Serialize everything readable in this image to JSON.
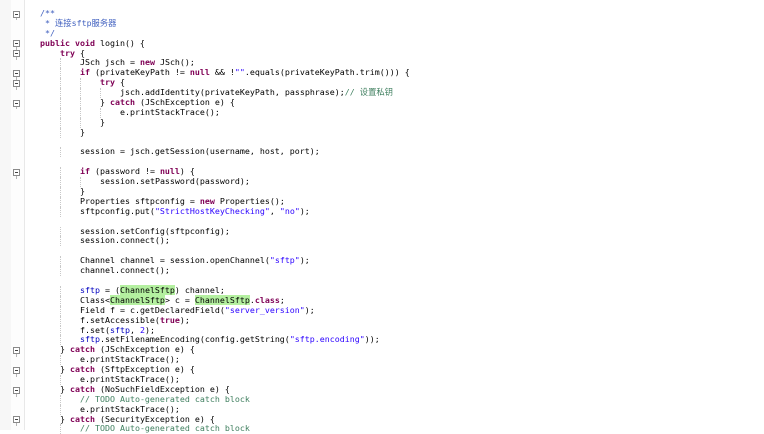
{
  "editor": {
    "lines": [
      {
        "indent": 0,
        "tokens": [
          [
            "jd",
            "/**"
          ]
        ]
      },
      {
        "indent": 0,
        "tokens": [
          [
            "jd",
            " * 连接sftp服务器"
          ]
        ]
      },
      {
        "indent": 0,
        "tokens": [
          [
            "jd",
            " */"
          ]
        ]
      },
      {
        "indent": 0,
        "tokens": [
          [
            "k",
            "public"
          ],
          [
            "n",
            " "
          ],
          [
            "k",
            "void"
          ],
          [
            "n",
            " login() {"
          ]
        ]
      },
      {
        "indent": 1,
        "tokens": [
          [
            "k",
            "try"
          ],
          [
            "n",
            " {"
          ]
        ]
      },
      {
        "indent": 2,
        "tokens": [
          [
            "n",
            "JSch jsch = "
          ],
          [
            "k",
            "new"
          ],
          [
            "n",
            " JSch();"
          ]
        ]
      },
      {
        "indent": 2,
        "tokens": [
          [
            "k",
            "if"
          ],
          [
            "n",
            " (privateKeyPath != "
          ],
          [
            "k",
            "null"
          ],
          [
            "n",
            " && !"
          ],
          [
            "s",
            "\"\""
          ],
          [
            "n",
            ".equals(privateKeyPath.trim())) {"
          ]
        ]
      },
      {
        "indent": 3,
        "tokens": [
          [
            "k",
            "try"
          ],
          [
            "n",
            " {"
          ]
        ]
      },
      {
        "indent": 4,
        "tokens": [
          [
            "n",
            "jsch.addIdentity(privateKeyPath, passphrase);"
          ],
          [
            "c",
            "// 设置私钥"
          ]
        ]
      },
      {
        "indent": 3,
        "tokens": [
          [
            "n",
            "} "
          ],
          [
            "k",
            "catch"
          ],
          [
            "n",
            " (JSchException e) {"
          ]
        ]
      },
      {
        "indent": 4,
        "tokens": [
          [
            "n",
            "e.printStackTrace();"
          ]
        ]
      },
      {
        "indent": 3,
        "tokens": [
          [
            "n",
            "}"
          ]
        ]
      },
      {
        "indent": 2,
        "tokens": [
          [
            "n",
            "}"
          ]
        ]
      },
      {
        "indent": 0,
        "tokens": []
      },
      {
        "indent": 2,
        "tokens": [
          [
            "n",
            "session = jsch.getSession(username, host, port);"
          ]
        ]
      },
      {
        "indent": 0,
        "tokens": []
      },
      {
        "indent": 2,
        "tokens": [
          [
            "k",
            "if"
          ],
          [
            "n",
            " (password != "
          ],
          [
            "k",
            "null"
          ],
          [
            "n",
            ") {"
          ]
        ]
      },
      {
        "indent": 3,
        "tokens": [
          [
            "n",
            "session.setPassword(password);"
          ]
        ]
      },
      {
        "indent": 2,
        "tokens": [
          [
            "n",
            "}"
          ]
        ]
      },
      {
        "indent": 2,
        "tokens": [
          [
            "n",
            "Properties sftpconfig = "
          ],
          [
            "k",
            "new"
          ],
          [
            "n",
            " Properties();"
          ]
        ]
      },
      {
        "indent": 2,
        "tokens": [
          [
            "n",
            "sftpconfig.put("
          ],
          [
            "s",
            "\"StrictHostKeyChecking\""
          ],
          [
            "n",
            ", "
          ],
          [
            "s",
            "\"no\""
          ],
          [
            "n",
            ");"
          ]
        ]
      },
      {
        "indent": 0,
        "tokens": []
      },
      {
        "indent": 2,
        "tokens": [
          [
            "n",
            "session.setConfig(sftpconfig);"
          ]
        ]
      },
      {
        "indent": 2,
        "tokens": [
          [
            "n",
            "session.connect();"
          ]
        ]
      },
      {
        "indent": 0,
        "tokens": []
      },
      {
        "indent": 2,
        "tokens": [
          [
            "n",
            "Channel channel = session.openChannel("
          ],
          [
            "s",
            "\"sftp\""
          ],
          [
            "n",
            ");"
          ]
        ]
      },
      {
        "indent": 2,
        "tokens": [
          [
            "n",
            "channel.connect();"
          ]
        ]
      },
      {
        "indent": 0,
        "tokens": []
      },
      {
        "indent": 2,
        "tokens": [
          [
            "f",
            "sftp"
          ],
          [
            "n",
            " = ("
          ],
          [
            "hl",
            "ChannelSftp"
          ],
          [
            "n",
            ") channel;"
          ]
        ]
      },
      {
        "indent": 2,
        "tokens": [
          [
            "n",
            "Class<"
          ],
          [
            "hl",
            "ChannelSftp"
          ],
          [
            "n",
            "> c = "
          ],
          [
            "hl",
            "ChannelSftp"
          ],
          [
            "n",
            "."
          ],
          [
            "k",
            "class"
          ],
          [
            "n",
            ";"
          ]
        ]
      },
      {
        "indent": 2,
        "tokens": [
          [
            "n",
            "Field f = c.getDeclaredField("
          ],
          [
            "s",
            "\"server_version\""
          ],
          [
            "n",
            ");"
          ]
        ]
      },
      {
        "indent": 2,
        "tokens": [
          [
            "n",
            "f.setAccessible("
          ],
          [
            "k",
            "true"
          ],
          [
            "n",
            ");"
          ]
        ]
      },
      {
        "indent": 2,
        "tokens": [
          [
            "n",
            "f.set("
          ],
          [
            "f",
            "sftp"
          ],
          [
            "n",
            ", "
          ],
          [
            "s",
            "2"
          ],
          [
            "n",
            ");"
          ]
        ]
      },
      {
        "indent": 2,
        "tokens": [
          [
            "f",
            "sftp"
          ],
          [
            "n",
            ".setFilenameEncoding(config.getString("
          ],
          [
            "s",
            "\"sftp.encoding\""
          ],
          [
            "n",
            "));"
          ]
        ]
      },
      {
        "indent": 1,
        "tokens": [
          [
            "n",
            "} "
          ],
          [
            "k",
            "catch"
          ],
          [
            "n",
            " (JSchException e) {"
          ]
        ]
      },
      {
        "indent": 2,
        "tokens": [
          [
            "n",
            "e.printStackTrace();"
          ]
        ]
      },
      {
        "indent": 1,
        "tokens": [
          [
            "n",
            "} "
          ],
          [
            "k",
            "catch"
          ],
          [
            "n",
            " (SftpException e) {"
          ]
        ]
      },
      {
        "indent": 2,
        "tokens": [
          [
            "n",
            "e.printStackTrace();"
          ]
        ]
      },
      {
        "indent": 1,
        "tokens": [
          [
            "n",
            "} "
          ],
          [
            "k",
            "catch"
          ],
          [
            "n",
            " (NoSuchFieldException e) {"
          ]
        ]
      },
      {
        "indent": 2,
        "tokens": [
          [
            "c",
            "// TODO Auto-generated catch block"
          ]
        ]
      },
      {
        "indent": 2,
        "tokens": [
          [
            "n",
            "e.printStackTrace();"
          ]
        ]
      },
      {
        "indent": 1,
        "tokens": [
          [
            "n",
            "} "
          ],
          [
            "k",
            "catch"
          ],
          [
            "n",
            " (SecurityException e) {"
          ]
        ]
      },
      {
        "indent": 2,
        "tokens": [
          [
            "c",
            "// TODO Auto-generated catch block"
          ]
        ]
      }
    ],
    "folds": [
      0,
      3,
      4,
      6,
      7,
      9,
      16,
      34,
      36,
      38,
      41
    ],
    "fold_icon": "minus-icon",
    "colors": {
      "keyword": "#7f0055",
      "comment": "#3f7f5f",
      "javadoc": "#3f5fbf",
      "string": "#2a00ff",
      "field": "#0000c0",
      "highlight": "#b4f0a0"
    }
  }
}
